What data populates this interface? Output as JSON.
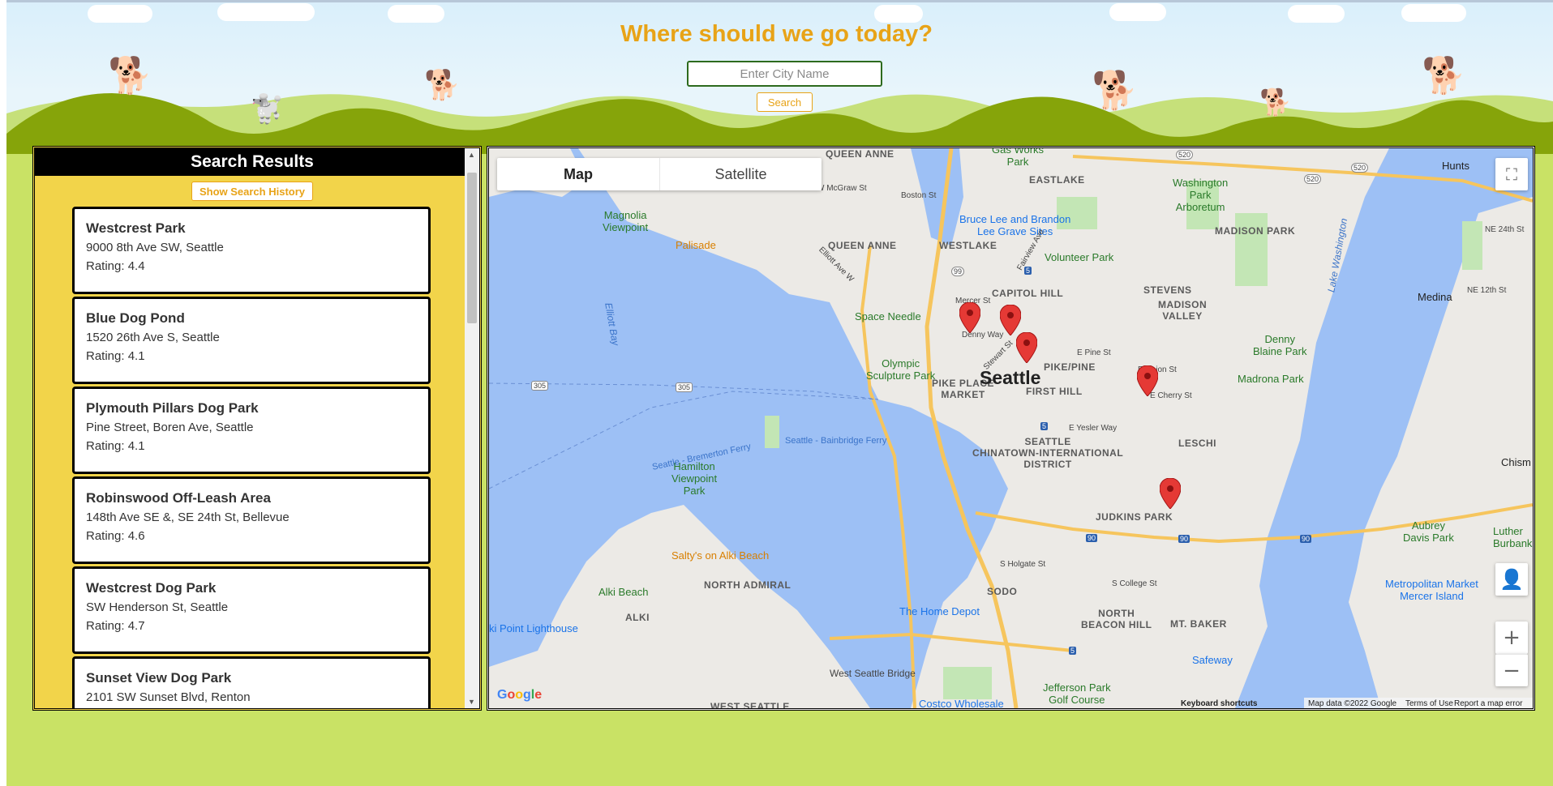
{
  "header": {
    "title": "Where should we go today?",
    "city_placeholder": "Enter City Name",
    "search_label": "Search"
  },
  "results": {
    "heading": "Search Results",
    "history_label": "Show Search History",
    "items": [
      {
        "name": "Westcrest Park",
        "address": "9000 8th Ave SW, Seattle",
        "rating": "Rating: 4.4"
      },
      {
        "name": "Blue Dog Pond",
        "address": "1520 26th Ave S, Seattle",
        "rating": "Rating: 4.1"
      },
      {
        "name": "Plymouth Pillars Dog Park",
        "address": "Pine Street, Boren Ave, Seattle",
        "rating": "Rating: 4.1"
      },
      {
        "name": "Robinswood Off-Leash Area",
        "address": "148th Ave SE &, SE 24th St, Bellevue",
        "rating": "Rating: 4.6"
      },
      {
        "name": "Westcrest Dog Park",
        "address": "SW Henderson St, Seattle",
        "rating": "Rating: 4.7"
      },
      {
        "name": "Sunset View Dog Park",
        "address": "2101 SW Sunset Blvd, Renton",
        "rating": ""
      }
    ]
  },
  "map": {
    "map_tab": "Map",
    "satellite_tab": "Satellite",
    "google_logo": "Google",
    "keyboard_shortcuts": "Keyboard shortcuts",
    "map_data": "Map data ©2022 Google",
    "terms": "Terms of Use",
    "report": "Report a map error",
    "labels": {
      "seattle": "Seattle",
      "queen_anne_top": "QUEEN ANNE",
      "queen_anne": "QUEEN ANNE",
      "westlake": "WESTLAKE",
      "eastlake": "EASTLAKE",
      "capitol_hill": "CAPITOL HILL",
      "stevens": "STEVENS",
      "madison_valley": "MADISON\nVALLEY",
      "madison_park": "MADISON PARK",
      "pike_pine": "PIKE/PINE",
      "first_hill": "FIRST HILL",
      "pike_place": "PIKE PLACE\nMARKET",
      "leschi": "LESCHI",
      "seattle_chinatown": "SEATTLE\nCHINATOWN-INTERNATIONAL\nDISTRICT",
      "judkins_park": "JUDKINS PARK",
      "sodo": "SODO",
      "north_admiral": "NORTH ADMIRAL",
      "alki": "ALKI",
      "north_beacon_hill": "NORTH\nBEACON HILL",
      "mt_baker": "MT. BAKER",
      "west_seattle": "WEST SEATTLE",
      "medina": "Medina",
      "hunts": "Hunts",
      "chism_beach": "Chism Be",
      "gas_works": "Gas Works\nPark",
      "washington_park": "Washington\nPark\nArboretum",
      "bruce_lee": "Bruce Lee and Brandon\nLee Grave Sites",
      "volunteer_park": "Volunteer Park",
      "magnolia": "Magnolia\nViewpoint",
      "palisade": "Palisade",
      "space_needle": "Space Needle",
      "olympic": "Olympic\nSculpture Park",
      "denny_blaine": "Denny\nBlaine Park",
      "madrona_park": "Madrona Park",
      "elliott_bay": "Elliott Bay",
      "lake_washington": "Lake Washington",
      "hamilton": "Hamilton\nViewpoint\nPark",
      "saltys": "Salty's on Alki Beach",
      "alki_beach": "Alki Beach",
      "alki_lighthouse": "ki Point Lighthouse",
      "home_depot": "The Home Depot",
      "safeway": "Safeway",
      "metropolitan": "Metropolitan Market\nMercer Island",
      "aubrey": "Aubrey\nDavis Park",
      "luther": "Luther\nBurbank Pa",
      "jefferson": "Jefferson Park\nGolf Course",
      "costco": "Costco Wholesale",
      "bainbridge_ferry": "Seattle - Bainbridge Ferry",
      "bremerton_ferry": "Seattle - Bremerton Ferry",
      "west_seattle_bridge": "West Seattle Bridge",
      "mercer_st": "Mercer St",
      "denny_way": "Denny Way",
      "stewart_st": "Stewart St",
      "e_pine_st": "E Pine St",
      "e_union_st": "E Union St",
      "e_cherry_st": "E Cherry St",
      "e_yesler_way": "E Yesler Way",
      "s_holgate_st": "S Holgate St",
      "s_college_st": "S College St",
      "boston_st": "Boston St",
      "w_mcgraw_st": "W McGraw St",
      "elliott_ave_w": "Elliott Ave W",
      "fairview_ave": "Fairview Ave",
      "r305a": "305",
      "r305b": "305",
      "r99": "99",
      "r5a": "5",
      "r5b": "5",
      "r5c": "5",
      "r520a": "520",
      "r520b": "520",
      "r520c": "520",
      "r90a": "90",
      "r90b": "90",
      "r90c": "90",
      "ne_24th": "NE 24th St",
      "ne_12th": "NE 12th St"
    }
  },
  "colors": {
    "accent": "#e8a317",
    "grass": "#c9e265",
    "hill": "#86a40a",
    "panel": "#f2d44a",
    "water": "#9dc0f5",
    "pin": "#e53935"
  }
}
